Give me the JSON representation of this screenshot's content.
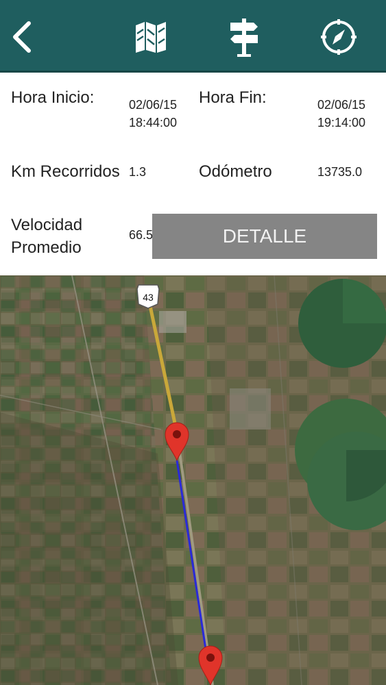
{
  "header": {
    "icons": {
      "back": "chevron-left-icon",
      "map": "map-icon",
      "signpost": "signpost-icon",
      "compass": "compass-icon"
    },
    "color": "#1f5e5f"
  },
  "trip": {
    "start_label": "Hora Inicio:",
    "start_date": "02/06/15",
    "start_time": "18:44:00",
    "end_label": "Hora Fin:",
    "end_date": "02/06/15",
    "end_time": "19:14:00",
    "km_label": "Km Recorridos",
    "km_value": "1.3",
    "odometer_label": "Odómetro",
    "odometer_value": "13735.0",
    "speed_label_line1": "Velocidad",
    "speed_label_line2": "Promedio",
    "speed_value": "66.5",
    "detail_button": "DETALLE"
  },
  "map": {
    "route_shield": "43",
    "route_color": "#2a2ad8",
    "marker_color": "#e0342a"
  }
}
